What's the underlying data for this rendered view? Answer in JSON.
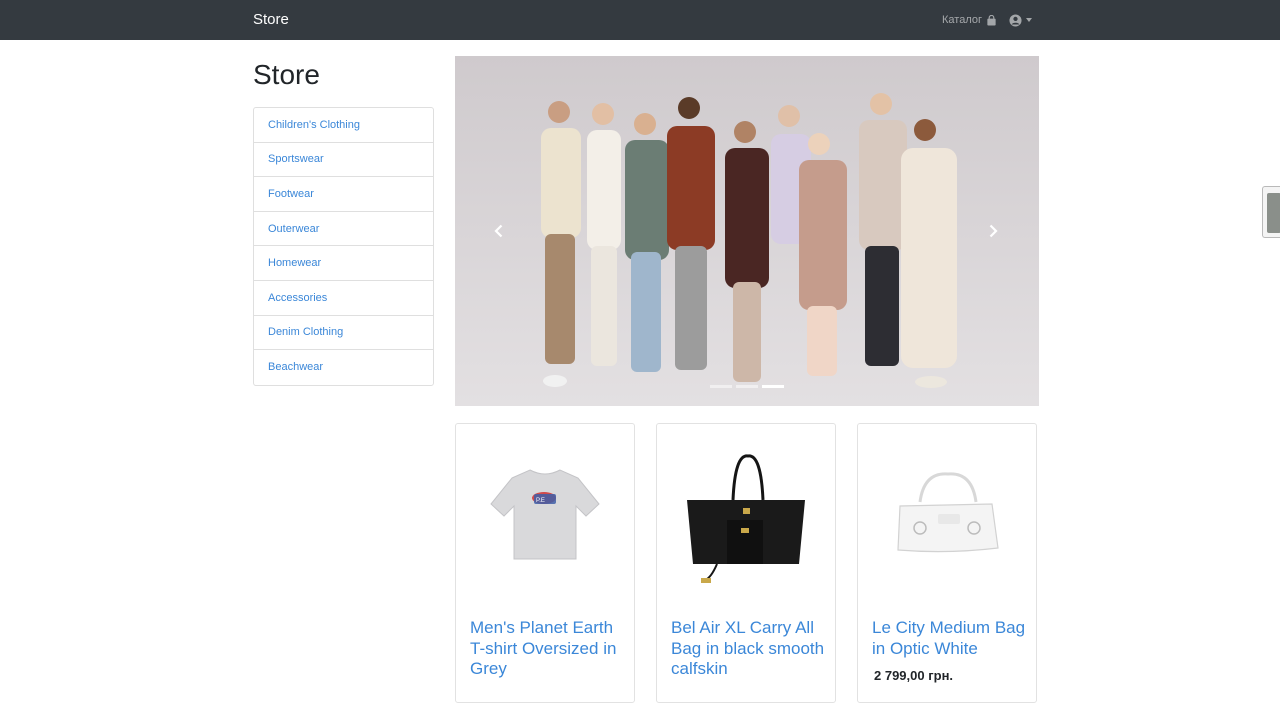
{
  "navbar": {
    "brand": "Store",
    "catalog_label": "Каталог",
    "catalog_icon": "shopping-bag-icon",
    "user_icon": "user-circle-icon"
  },
  "sidebar": {
    "title": "Store",
    "categories": [
      {
        "label": "Children's Clothing"
      },
      {
        "label": "Sportswear"
      },
      {
        "label": "Footwear"
      },
      {
        "label": "Outerwear"
      },
      {
        "label": "Homewear"
      },
      {
        "label": "Accessories"
      },
      {
        "label": "Denim Clothing"
      },
      {
        "label": "Beachwear"
      }
    ]
  },
  "carousel": {
    "slide_count": 3,
    "active_index": 2,
    "prev_icon": "chevron-left-icon",
    "next_icon": "chevron-right-icon"
  },
  "products": [
    {
      "title": "Men's Planet Earth T-shirt Oversized in Grey",
      "price": "",
      "image_icon": "tshirt-image"
    },
    {
      "title": "Bel Air XL Carry All Bag in black smooth calfskin",
      "price": "",
      "image_icon": "black-tote-bag-image"
    },
    {
      "title": "Le City Medium Bag in Optic White",
      "price": "2 799,00 грн.",
      "image_icon": "white-handbag-image"
    }
  ],
  "colors": {
    "navbar_bg": "#343a40",
    "link": "#3b87d8"
  }
}
